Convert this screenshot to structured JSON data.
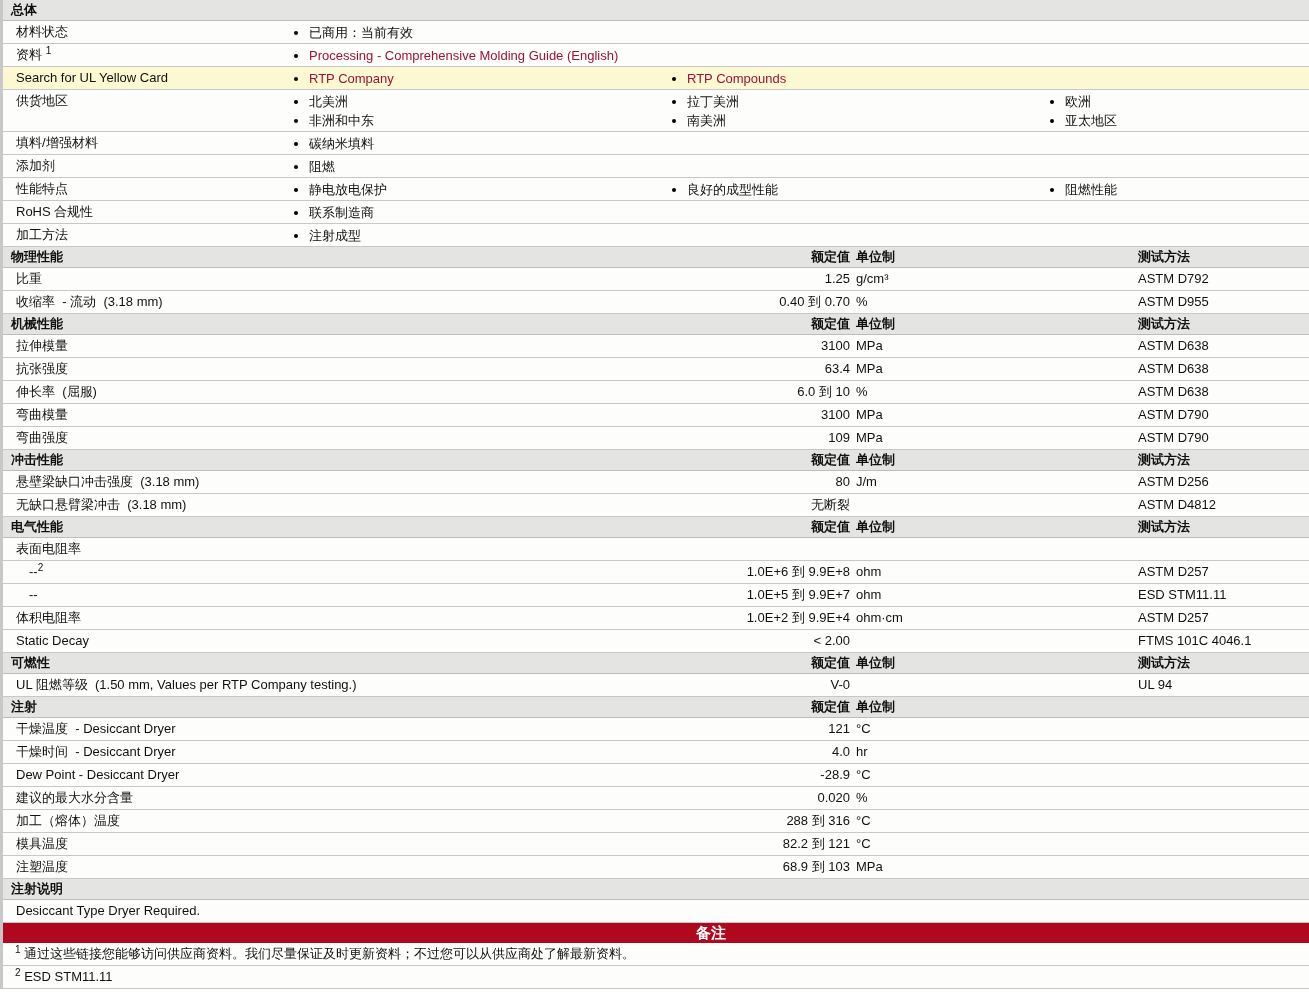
{
  "general": {
    "title": "总体",
    "rows": [
      {
        "label": "材料状态",
        "highlighted": false,
        "items": [
          {
            "text": "已商用：当前有效",
            "link": false
          }
        ]
      },
      {
        "label": "资料 $^{1}$",
        "highlighted": false,
        "items": [
          {
            "text": "Processing - Comprehensive Molding Guide (English)",
            "link": true
          }
        ]
      },
      {
        "label": "Search for UL Yellow Card",
        "highlighted": true,
        "items": [
          {
            "text": "RTP Company",
            "link": true
          },
          {
            "text": "RTP Compounds",
            "link": true
          }
        ]
      },
      {
        "label": "供货地区",
        "highlighted": false,
        "items": [
          {
            "text": "北美洲",
            "link": false
          },
          {
            "text": "拉丁美洲",
            "link": false
          },
          {
            "text": "欧洲",
            "link": false
          },
          {
            "text": "非洲和中东",
            "link": false
          },
          {
            "text": "南美洲",
            "link": false
          },
          {
            "text": "亚太地区",
            "link": false
          }
        ]
      },
      {
        "label": "填料/增强材料",
        "highlighted": false,
        "items": [
          {
            "text": "碳纳米填料",
            "link": false
          }
        ]
      },
      {
        "label": "添加剂",
        "highlighted": false,
        "items": [
          {
            "text": "阻燃",
            "link": false
          }
        ]
      },
      {
        "label": "性能特点",
        "highlighted": false,
        "items": [
          {
            "text": "静电放电保护",
            "link": false
          },
          {
            "text": "良好的成型性能",
            "link": false
          },
          {
            "text": "阻燃性能",
            "link": false
          }
        ]
      },
      {
        "label": "RoHS 合规性",
        "highlighted": false,
        "items": [
          {
            "text": "联系制造商",
            "link": false
          }
        ]
      },
      {
        "label": "加工方法",
        "highlighted": false,
        "items": [
          {
            "text": "注射成型",
            "link": false
          }
        ]
      }
    ]
  },
  "sections": [
    {
      "title": "物理性能",
      "value_heading": "额定值",
      "unit_heading": "单位制",
      "method_heading": "测试方法",
      "rows": [
        {
          "label": "比重",
          "value": "1.25",
          "unit": "g/cm³",
          "method": "ASTM D792"
        },
        {
          "label": "收缩率  - 流动  (3.18 mm)",
          "value": "0.40 到  0.70",
          "unit": "%",
          "method": "ASTM D955"
        }
      ]
    },
    {
      "title": "机械性能",
      "value_heading": "额定值",
      "unit_heading": "单位制",
      "method_heading": "测试方法",
      "rows": [
        {
          "label": "拉伸模量",
          "value": "3100",
          "unit": "MPa",
          "method": "ASTM D638"
        },
        {
          "label": "抗张强度",
          "value": "63.4",
          "unit": "MPa",
          "method": "ASTM D638"
        },
        {
          "label": "伸长率  (屈服)",
          "value": "6.0 到  10",
          "unit": "%",
          "method": "ASTM D638"
        },
        {
          "label": "弯曲模量",
          "value": "3100",
          "unit": "MPa",
          "method": "ASTM D790"
        },
        {
          "label": "弯曲强度",
          "value": "109",
          "unit": "MPa",
          "method": "ASTM D790"
        }
      ]
    },
    {
      "title": "冲击性能",
      "value_heading": "额定值",
      "unit_heading": "单位制",
      "method_heading": "测试方法",
      "rows": [
        {
          "label": "悬壁梁缺口冲击强度  (3.18 mm)",
          "value": "80",
          "unit": "J/m",
          "method": "ASTM D256"
        },
        {
          "label": "无缺口悬臂梁冲击  (3.18 mm)",
          "value": "无断裂",
          "method": "ASTM D4812"
        }
      ]
    },
    {
      "title": "电气性能",
      "value_heading": "额定值",
      "unit_heading": "单位制",
      "method_heading": "测试方法",
      "rows": [
        {
          "label": "表面电阻率",
          "children": [
            {
              "label": "--$^{2}$",
              "value": "1.0E+6 到  9.9E+8",
              "unit": "ohm",
              "method": "ASTM D257"
            },
            {
              "label": "--",
              "value": "1.0E+5 到  9.9E+7",
              "unit": "ohm",
              "method": "ESD STM11.11"
            }
          ]
        },
        {
          "label": "体积电阻率",
          "value": "1.0E+2 到  9.9E+4",
          "unit": "ohm·cm",
          "method": "ASTM D257"
        },
        {
          "label": "Static Decay",
          "value": "< 2.00",
          "method": "FTMS 101C 4046.1"
        }
      ]
    },
    {
      "title": "可燃性",
      "value_heading": "额定值",
      "unit_heading": "单位制",
      "method_heading": "测试方法",
      "rows": [
        {
          "label": "UL 阻燃等级  (1.50 mm, Values per RTP Company testing.)",
          "value": "V-0",
          "method": "UL 94"
        }
      ]
    },
    {
      "title": "注射",
      "value_heading": "额定值",
      "unit_heading": "单位制",
      "rows": [
        {
          "label": "干燥温度  - Desiccant Dryer",
          "value": "121",
          "unit": "°C"
        },
        {
          "label": "干燥时间  - Desiccant Dryer",
          "value": "4.0",
          "unit": "hr"
        },
        {
          "label": "Dew Point - Desiccant Dryer",
          "value": "-28.9",
          "unit": "°C"
        },
        {
          "label": "建议的最大水分含量",
          "value": "0.020",
          "unit": "%"
        },
        {
          "label": "加工（熔体）温度",
          "value": "288 到  316",
          "unit": "°C"
        },
        {
          "label": "模具温度",
          "value": "82.2 到  121",
          "unit": "°C"
        },
        {
          "label": "注塑温度",
          "value": "68.9 到  103",
          "unit": "MPa"
        }
      ]
    },
    {
      "title": "注射说明",
      "text": "Desiccant Type Dryer Required."
    }
  ],
  "notes": {
    "title": "备注",
    "items": [
      {
        "text": "$^{1}$ 通过这些链接您能够访问供应商资料。我们尽量保证及时更新资料；不过您可以从供应商处了解最新资料。"
      },
      {
        "text": "$^{2}$ ESD STM11.11"
      }
    ]
  }
}
